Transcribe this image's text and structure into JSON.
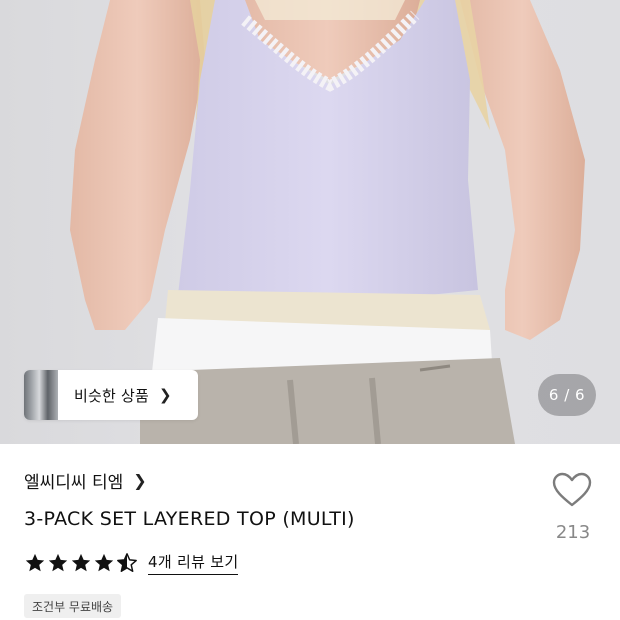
{
  "gallery": {
    "similar_products_label": "비슷한 상품",
    "similar_products_chevron": "chevron-right-icon",
    "page_counter": "6 / 6"
  },
  "product": {
    "brand": "엘씨디씨 티엠",
    "brand_chevron": "chevron-right-icon",
    "title": "3-PACK SET LAYERED TOP (MULTI)",
    "wishlist_icon": "heart-outline-icon",
    "wishlist_count": "213",
    "rating_stars": 4.5,
    "review_link": "4개 리뷰 보기",
    "shipping_badge": "조건부 무료배송"
  },
  "colors": {
    "star": "#111111",
    "wishlist_count": "#888888",
    "badge_bg": "#efefef"
  }
}
